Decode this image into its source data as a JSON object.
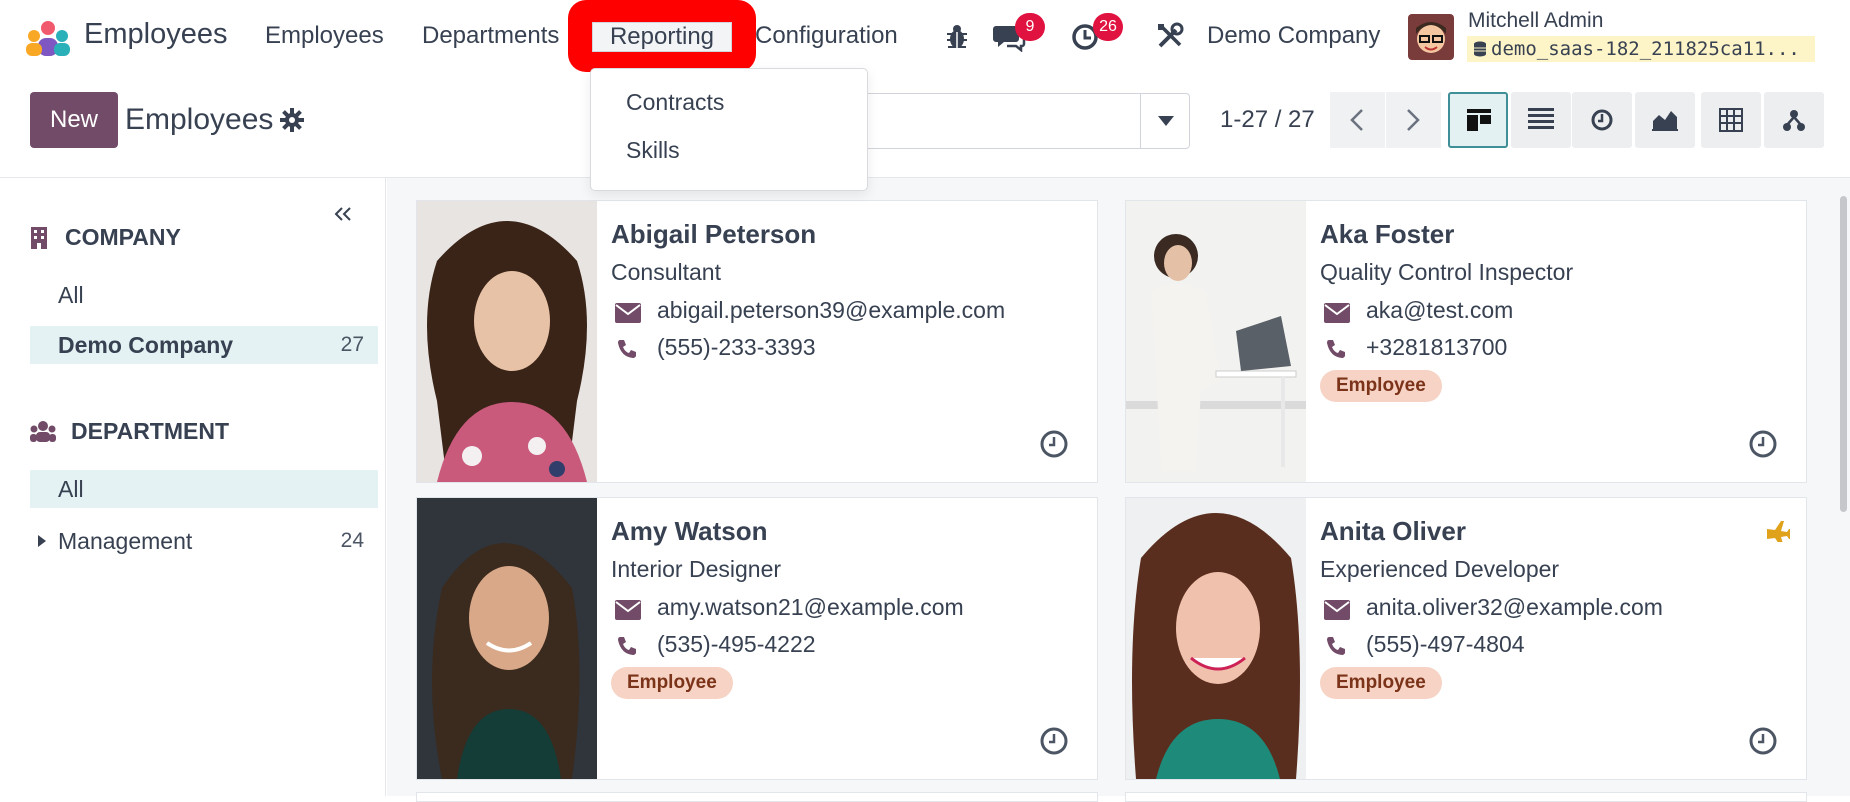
{
  "navbar": {
    "app_name": "Employees",
    "menus": [
      "Employees",
      "Departments",
      "Reporting",
      "Configuration"
    ],
    "messages_badge": "9",
    "activities_badge": "26",
    "company": "Demo Company",
    "user_name": "Mitchell Admin",
    "database": "demo_saas-182_211825ca11..."
  },
  "reporting_menu": {
    "items": [
      "Contracts",
      "Skills"
    ]
  },
  "control_panel": {
    "new_label": "New",
    "title": "Employees",
    "pager": "1-27 / 27"
  },
  "sidebar": {
    "company_heading": "COMPANY",
    "company_items": [
      {
        "label": "All",
        "count": ""
      },
      {
        "label": "Demo Company",
        "count": "27"
      }
    ],
    "department_heading": "DEPARTMENT",
    "department_items": [
      {
        "label": "All",
        "count": ""
      },
      {
        "label": "Management",
        "count": "24"
      }
    ]
  },
  "employees": [
    {
      "name": "Abigail Peterson",
      "job": "Consultant",
      "email": "abigail.peterson39@example.com",
      "phone": "(555)-233-3393",
      "tag": ""
    },
    {
      "name": "Aka Foster",
      "job": "Quality Control Inspector",
      "email": "aka@test.com",
      "phone": "+3281813700",
      "tag": "Employee"
    },
    {
      "name": "Amy Watson",
      "job": "Interior Designer",
      "email": "amy.watson21@example.com",
      "phone": "(535)-495-4222",
      "tag": "Employee"
    },
    {
      "name": "Anita Oliver",
      "job": "Experienced Developer",
      "email": "anita.oliver32@example.com",
      "phone": "(555)-497-4804",
      "tag": "Employee"
    }
  ],
  "colors": {
    "brand": "#714b67",
    "highlight": "#ff0000",
    "badge": "#e0123f",
    "tag_bg": "#f6d3c4",
    "active_view": "#3f8f98"
  }
}
